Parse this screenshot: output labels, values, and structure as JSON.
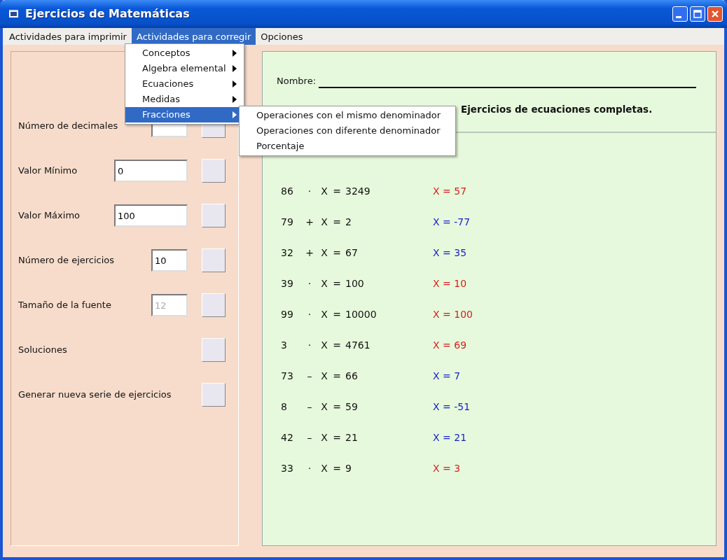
{
  "window": {
    "title": "Ejercicios de Matemáticas"
  },
  "menu_bar": [
    {
      "label": "Actividades para imprimir",
      "selected": false
    },
    {
      "label": "Actividades para corregir",
      "selected": true
    },
    {
      "label": "Opciones",
      "selected": false
    }
  ],
  "dropdown": [
    {
      "label": "Conceptos",
      "selected": false
    },
    {
      "label": "Algebra elemental",
      "selected": false
    },
    {
      "label": "Ecuaciones",
      "selected": false
    },
    {
      "label": "Medidas",
      "selected": false
    },
    {
      "label": "Fracciones",
      "selected": true
    }
  ],
  "submenu": [
    {
      "label": "Operaciones con el mismo denominador"
    },
    {
      "label": "Operaciones con diferente denominador"
    },
    {
      "label": "Porcentaje"
    }
  ],
  "settings": [
    {
      "label": "Número de decimales",
      "kind": "narrow"
    },
    {
      "label": "Valor Mínimo",
      "kind": "wide",
      "value": "0",
      "disabled": false
    },
    {
      "label": "Valor Máximo",
      "kind": "wide",
      "value": "100",
      "disabled": false
    },
    {
      "label": "Número de ejercicios",
      "kind": "narrow",
      "value": "10",
      "disabled": false
    },
    {
      "label": "Tamaño de la fuente",
      "kind": "narrow",
      "value": "12",
      "disabled": true
    },
    {
      "label": "Soluciones",
      "kind": "button"
    },
    {
      "label": "Generar nueva serie de ejercicios",
      "kind": "button"
    }
  ],
  "worksheet": {
    "name_label": "Nombre:",
    "title": "Ejercicios de ecuaciones completas.",
    "equations": [
      {
        "a": "86",
        "op": "·",
        "x": "X",
        "eq": "=",
        "b": "3249",
        "solution": "X = 57",
        "color": "#d42020"
      },
      {
        "a": "79",
        "op": "+",
        "x": "X",
        "eq": "=",
        "b": "2",
        "solution": "X = -77",
        "color": "#1a22c8"
      },
      {
        "a": "32",
        "op": "+",
        "x": "X",
        "eq": "=",
        "b": "67",
        "solution": "X = 35",
        "color": "#1a22c8"
      },
      {
        "a": "39",
        "op": "·",
        "x": "X",
        "eq": "=",
        "b": "100",
        "solution": "X = 10",
        "color": "#d42020"
      },
      {
        "a": "99",
        "op": "·",
        "x": "X",
        "eq": "=",
        "b": "10000",
        "solution": "X = 100",
        "color": "#d42020"
      },
      {
        "a": "3",
        "op": "·",
        "x": "X",
        "eq": "=",
        "b": "4761",
        "solution": "X = 69",
        "color": "#d42020"
      },
      {
        "a": "73",
        "op": "–",
        "x": "X",
        "eq": "=",
        "b": "66",
        "solution": "X = 7",
        "color": "#1a22c8"
      },
      {
        "a": "8",
        "op": "–",
        "x": "X",
        "eq": "=",
        "b": "59",
        "solution": "X = -51",
        "color": "#1a22c8"
      },
      {
        "a": "42",
        "op": "–",
        "x": "X",
        "eq": "=",
        "b": "21",
        "solution": "X = 21",
        "color": "#1a22c8"
      },
      {
        "a": "33",
        "op": "·",
        "x": "X",
        "eq": "=",
        "b": "9",
        "solution": "X = 3",
        "color": "#d42020"
      }
    ]
  }
}
